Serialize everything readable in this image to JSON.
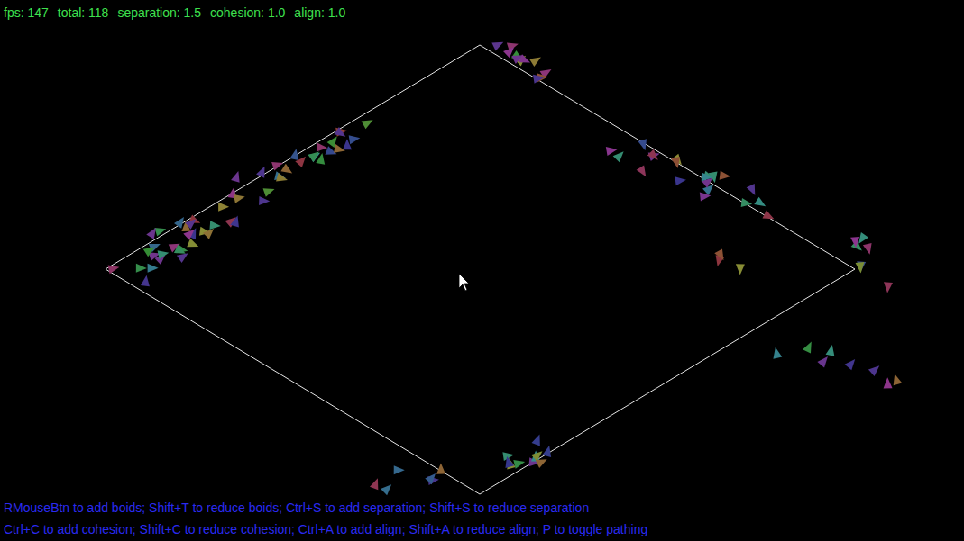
{
  "status": [
    {
      "label": "fps:",
      "value": "147"
    },
    {
      "label": "total:",
      "value": "118"
    },
    {
      "label": "separation:",
      "value": "1.5"
    },
    {
      "label": "cohesion:",
      "value": "1.0"
    },
    {
      "label": "align:",
      "value": "1.0"
    }
  ],
  "help_lines": [
    "RMouseBtn to add boids; Shift+T to reduce boids; Ctrl+S to add separation; Shift+S to reduce separation",
    "Ctrl+C to add cohesion; Shift+C to reduce cohesion; Ctrl+A to add align; Shift+A to reduce align; P to toggle pathing"
  ]
}
